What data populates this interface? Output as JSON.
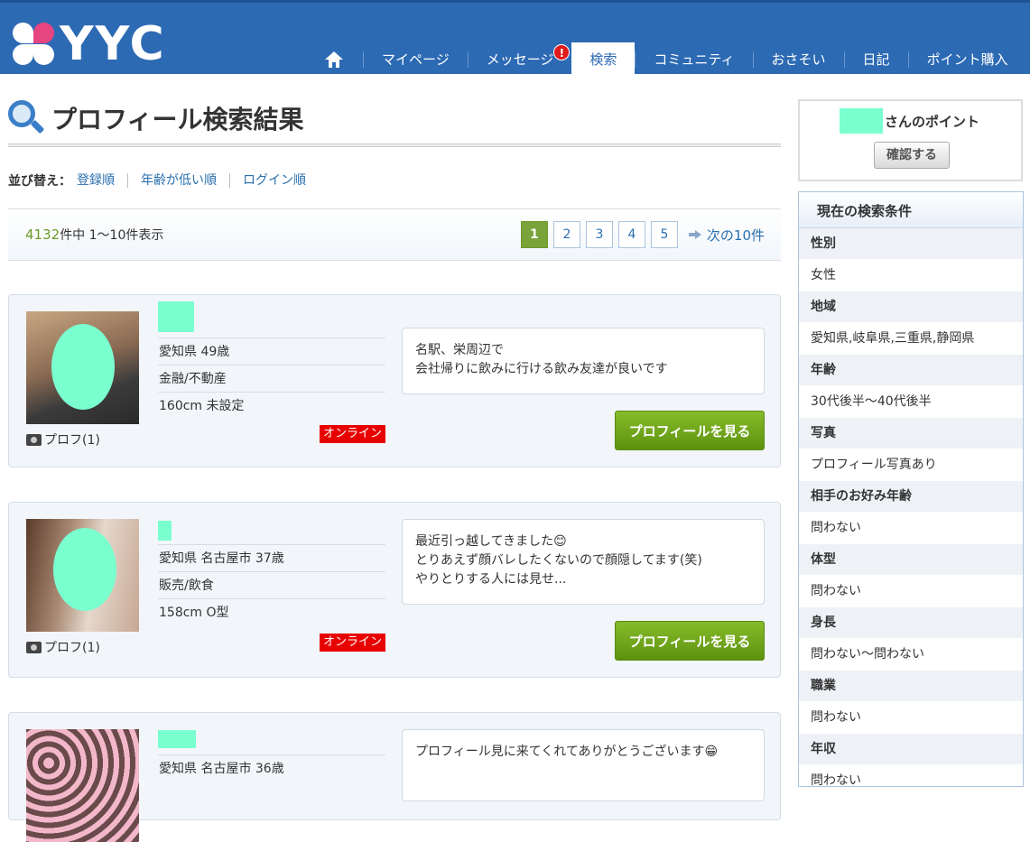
{
  "header": {
    "logo_text": "YYC",
    "nav": [
      {
        "label": ""
      },
      {
        "label": "マイページ"
      },
      {
        "label": "メッセージ",
        "badge": "!"
      },
      {
        "label": "検索"
      },
      {
        "label": "コミュニティ"
      },
      {
        "label": "おさそい"
      },
      {
        "label": "日記"
      },
      {
        "label": "ポイント購入"
      }
    ]
  },
  "main": {
    "title": "プロフィール検索結果",
    "sort": {
      "label": "並び替え：",
      "options": [
        "登録順",
        "年齢が低い順",
        "ログイン順"
      ]
    },
    "results": {
      "total": "4132",
      "suffix": "件中 1〜10件表示",
      "pages": [
        "1",
        "2",
        "3",
        "4",
        "5"
      ],
      "next_label": "次の10件"
    },
    "profiles": [
      {
        "location_age": "愛知県  49歳",
        "job": "金融/不動産",
        "body": "160cm  未設定",
        "photo_count": "プロフ(1)",
        "status": "オンライン",
        "message_lines": [
          "名駅、栄周辺で",
          "会社帰りに飲みに行ける飲み友達が良いです"
        ],
        "button": "プロフィールを見る"
      },
      {
        "location_age": "愛知県 名古屋市  37歳",
        "job": "販売/飲食",
        "body": "158cm  O型",
        "photo_count": "プロフ(1)",
        "status": "オンライン",
        "message_lines": [
          "最近引っ越してきました😊",
          "とりあえず顔バレしたくないので顔隠してます(笑)",
          "やりとりする人には見せ..."
        ],
        "button": "プロフィールを見る"
      },
      {
        "location_age": "愛知県 名古屋市  36歳",
        "message_lines": [
          "プロフィール見に来てくれてありがとうございます😁"
        ]
      }
    ]
  },
  "sidebar": {
    "points_label": "さんのポイント",
    "confirm_button": "確認する",
    "conditions_title": "現在の検索条件",
    "conditions": [
      {
        "label": "性別",
        "value": "女性"
      },
      {
        "label": "地域",
        "value": "愛知県,岐阜県,三重県,静岡県"
      },
      {
        "label": "年齢",
        "value": "30代後半〜40代後半"
      },
      {
        "label": "写真",
        "value": "プロフィール写真あり"
      },
      {
        "label": "相手のお好み年齢",
        "value": "問わない"
      },
      {
        "label": "体型",
        "value": "問わない"
      },
      {
        "label": "身長",
        "value": "問わない〜問わない"
      },
      {
        "label": "職業",
        "value": "問わない"
      },
      {
        "label": "年収",
        "value": "問わない"
      }
    ]
  },
  "colors": {
    "header_blue": "#2d6ab4",
    "accent_green": "#6c9a2a",
    "online_red": "#e80000",
    "mask_mint": "#7affcf"
  }
}
